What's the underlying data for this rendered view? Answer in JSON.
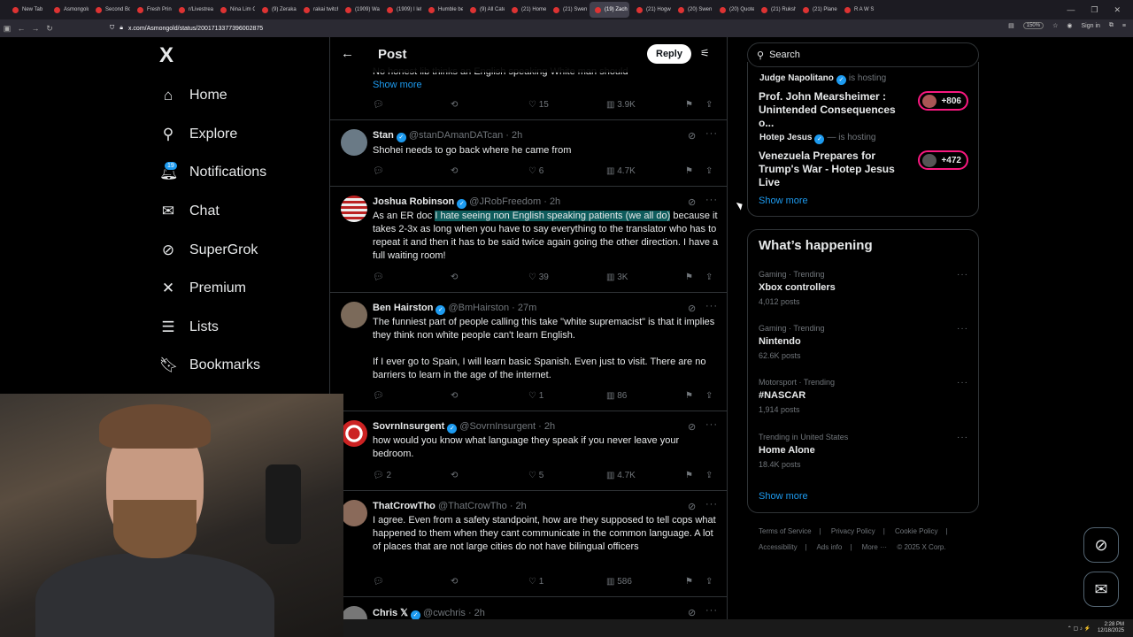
{
  "browser": {
    "tabs": [
      "New Tab",
      "Asmongold",
      "Second Bo",
      "Fresh Princ",
      "r/Livestrea",
      "Nina Lim Cl",
      "(9) Zeraka",
      "rakai twitch",
      "(1909) Wat",
      "(1909) I left",
      "Humble be",
      "(9) All Cate",
      "(21) Home",
      "(21) Swen V",
      "(19) Zach",
      "(21) Hogwa",
      "(20) Swen V",
      "(20) Quote",
      "(21) Ruksha",
      "(21) Plane C",
      "R A W S"
    ],
    "active_tab_index": 14,
    "url": "x.com/Asmongold/status/2001713377396002875",
    "zoom": "150%",
    "sign_in": "Sign in"
  },
  "nav": {
    "logo": "X",
    "items": [
      {
        "label": "Home",
        "icon": "home-icon"
      },
      {
        "label": "Explore",
        "icon": "search-icon"
      },
      {
        "label": "Notifications",
        "icon": "bell-icon"
      },
      {
        "label": "Chat",
        "icon": "mail-icon"
      },
      {
        "label": "SuperGrok",
        "icon": "grok-icon"
      },
      {
        "label": "Premium",
        "icon": "x-icon"
      },
      {
        "label": "Lists",
        "icon": "list-icon"
      },
      {
        "label": "Bookmarks",
        "icon": "bookmark-icon"
      }
    ],
    "notification_count": "19"
  },
  "header": {
    "title": "Post",
    "reply_label": "Reply"
  },
  "tweets": [
    {
      "text_partial": "No honest lib thinks an English speaking White man should",
      "show_more": "Show more",
      "replies": "",
      "retweets": "",
      "likes": "15",
      "views": "3.9K"
    },
    {
      "name": "Stan",
      "handle": "@stanDAmanDATcan",
      "time": "· 2h",
      "text": "Shohei needs to go back where he came from",
      "replies": "",
      "retweets": "",
      "likes": "6",
      "views": "4.7K"
    },
    {
      "name": "Joshua Robinson",
      "handle": "@JRobFreedom",
      "time": "· 2h",
      "text_pre": "As an ER doc ",
      "text_hl": "I hate seeing non English speaking patients (we all do)",
      "text_post": " because it takes 2-3x as long when you have to say everything to the translator who has to repeat it and then it has to be said twice again going the other direction. I have a full waiting room!",
      "replies": "",
      "retweets": "",
      "likes": "39",
      "views": "3K"
    },
    {
      "name": "Ben Hairston",
      "handle": "@BmHairston",
      "time": "· 27m",
      "text": "The funniest part of people calling this take \"white supremacist\" is that it implies they think non white people can't learn English.",
      "text2": "If I ever go to Spain, I will learn basic Spanish. Even just to visit. There are no barriers to learn in the age of the internet.",
      "replies": "",
      "retweets": "",
      "likes": "1",
      "views": "86"
    },
    {
      "name": "SovrnInsurgent",
      "handle": "@SovrnInsurgent",
      "time": "· 2h",
      "text": "how would you know what language they speak if you never leave your bedroom.",
      "replies": "2",
      "retweets": "",
      "likes": "5",
      "views": "4.7K"
    },
    {
      "name": "ThatCrowTho",
      "handle": "@ThatCrowTho",
      "time": "· 2h",
      "text": "I agree. Even from a safety standpoint, how are they supposed to tell cops what happened to them when they cant communicate in the common language. A lot of places that are not large cities do not have bilingual officers",
      "replies": "",
      "retweets": "",
      "likes": "1",
      "views": "586"
    },
    {
      "name": "Chris 𝕏",
      "handle": "@cwchris",
      "time": "· 2h"
    }
  ],
  "right": {
    "search_placeholder": "Search",
    "spaces": [
      {
        "host": "Judge Napolitano",
        "hosting": "is hosting",
        "title": "Prof. John Mearsheimer : Unintended Consequences o...",
        "count": "+806"
      },
      {
        "host": "Hotep Jesus",
        "hosting": "is hosting",
        "title": "Venezuela Prepares for Trump's War - Hotep Jesus Live",
        "count": "+472"
      }
    ],
    "spaces_show_more": "Show more",
    "whats_happening": "What’s happening",
    "trends": [
      {
        "meta": "Gaming · Trending",
        "name": "Xbox controllers",
        "count": "4,012 posts"
      },
      {
        "meta": "Gaming · Trending",
        "name": "Nintendo",
        "count": "62.6K posts"
      },
      {
        "meta": "Motorsport · Trending",
        "name": "#NASCAR",
        "count": "1,914 posts"
      },
      {
        "meta": "Trending in United States",
        "name": "Home Alone",
        "count": "18.4K posts"
      }
    ],
    "trends_show_more": "Show more",
    "footer": [
      "Terms of Service",
      "Privacy Policy",
      "Cookie Policy",
      "Accessibility",
      "Ads info",
      "More ···",
      "© 2025 X Corp."
    ]
  },
  "taskbar": {
    "time": "2:28 PM",
    "date": "12/18/2025"
  }
}
